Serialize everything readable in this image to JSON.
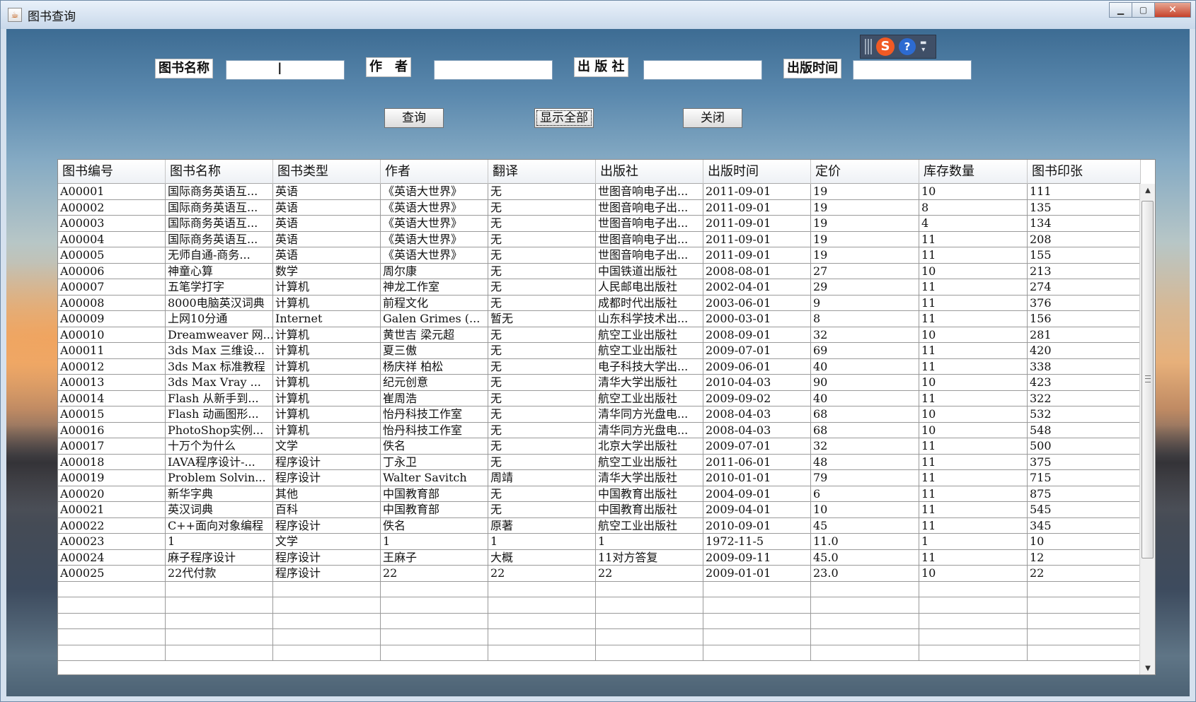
{
  "window": {
    "title": "图书查询"
  },
  "search": {
    "book_name_label": "图书名称",
    "author_label": "作　者",
    "publisher_label": "出 版 社",
    "pub_date_label": "出版时间",
    "book_name_value": "",
    "author_value": "",
    "publisher_value": "",
    "pub_date_value": ""
  },
  "buttons": {
    "query": "查询",
    "show_all": "显示全部",
    "close": "关闭"
  },
  "icons": {
    "app": "java-cup-icon",
    "ime_s": "S",
    "ime_help": "?"
  },
  "table": {
    "headers": [
      "图书编号",
      "图书名称",
      "图书类型",
      "作者",
      "翻译",
      "出版社",
      "出版时间",
      "定价",
      "库存数量",
      "图书印张"
    ],
    "rows": [
      [
        "A00001",
        "国际商务英语互...",
        "英语",
        "《英语大世界》",
        "无",
        "世图音响电子出...",
        "2011-09-01",
        "19",
        "10",
        "111"
      ],
      [
        "A00002",
        "国际商务英语互...",
        "英语",
        "《英语大世界》",
        "无",
        "世图音响电子出...",
        "2011-09-01",
        "19",
        "8",
        "135"
      ],
      [
        "A00003",
        "国际商务英语互...",
        "英语",
        "《英语大世界》",
        "无",
        "世图音响电子出...",
        "2011-09-01",
        "19",
        "4",
        "134"
      ],
      [
        "A00004",
        "国际商务英语互...",
        "英语",
        "《英语大世界》",
        "无",
        "世图音响电子出...",
        "2011-09-01",
        "19",
        "11",
        "208"
      ],
      [
        "A00005",
        "无师自通-商务...",
        "英语",
        "《英语大世界》",
        "无",
        "世图音响电子出...",
        "2011-09-01",
        "19",
        "11",
        "155"
      ],
      [
        "A00006",
        "神童心算",
        "数学",
        "周尔康",
        "无",
        "中国铁道出版社",
        "2008-08-01",
        "27",
        "10",
        "213"
      ],
      [
        "A00007",
        "五笔学打字",
        "计算机",
        "神龙工作室",
        "无",
        "人民邮电出版社",
        "2002-04-01",
        "29",
        "11",
        "274"
      ],
      [
        "A00008",
        "8000电脑英汉词典",
        "计算机",
        "前程文化",
        "无",
        "成都时代出版社",
        "2003-06-01",
        "9",
        "11",
        "376"
      ],
      [
        "A00009",
        "上网10分通",
        "Internet",
        "Galen Grimes (...",
        "暂无",
        "山东科学技术出...",
        "2000-03-01",
        "8",
        "11",
        "156"
      ],
      [
        "A00010",
        "Dreamweaver 网...",
        "计算机",
        "黄世吉 梁元超",
        "无",
        "航空工业出版社",
        "2008-09-01",
        "32",
        "10",
        "281"
      ],
      [
        "A00011",
        "3ds Max 三维设...",
        "计算机",
        "夏三傲",
        "无",
        "航空工业出版社",
        "2009-07-01",
        "69",
        "11",
        "420"
      ],
      [
        "A00012",
        "3ds Max 标准教程",
        "计算机",
        "杨庆祥 柏松",
        "无",
        "电子科技大学出...",
        "2009-06-01",
        "40",
        "11",
        "338"
      ],
      [
        "A00013",
        "3ds Max Vray ...",
        "计算机",
        "纪元创意",
        "无",
        "清华大学出版社",
        "2010-04-03",
        "90",
        "10",
        "423"
      ],
      [
        "A00014",
        "Flash 从新手到...",
        "计算机",
        "崔周浩",
        "无",
        "航空工业出版社",
        "2009-09-02",
        "40",
        "11",
        "322"
      ],
      [
        "A00015",
        "Flash 动画图形...",
        "计算机",
        "怡丹科技工作室",
        "无",
        "清华同方光盘电...",
        "2008-04-03",
        "68",
        "10",
        "532"
      ],
      [
        "A00016",
        "PhotoShop实例...",
        "计算机",
        "怡丹科技工作室",
        "无",
        "清华同方光盘电...",
        "2008-04-03",
        "68",
        "10",
        "548"
      ],
      [
        "A00017",
        "十万个为什么",
        "文学",
        "佚名",
        "无",
        "北京大学出版社",
        "2009-07-01",
        "32",
        "11",
        "500"
      ],
      [
        "A00018",
        "IAVA程序设计-...",
        "程序设计",
        "丁永卫",
        "无",
        "航空工业出版社",
        "2011-06-01",
        "48",
        "11",
        "375"
      ],
      [
        "A00019",
        "Problem Solvin...",
        "程序设计",
        "Walter Savitch",
        "周靖",
        "清华大学出版社",
        "2010-01-01",
        "79",
        "11",
        "715"
      ],
      [
        "A00020",
        "新华字典",
        "其他",
        "中国教育部",
        "无",
        "中国教育出版社",
        "2004-09-01",
        "6",
        "11",
        "875"
      ],
      [
        "A00021",
        "英汉词典",
        "百科",
        "中国教育部",
        "无",
        "中国教育出版社",
        "2009-04-01",
        "10",
        "11",
        "545"
      ],
      [
        "A00022",
        "C++面向对象编程",
        "程序设计",
        "佚名",
        "原著",
        "航空工业出版社",
        "2010-09-01",
        "45",
        "11",
        "345"
      ],
      [
        "A00023",
        "1",
        "文学",
        "1",
        "1",
        "1",
        "1972-11-5",
        "11.0",
        "1",
        "10"
      ],
      [
        "A00024",
        "麻子程序设计",
        "程序设计",
        "王麻子",
        "大概",
        "11对方答复",
        "2009-09-11",
        "45.0",
        "11",
        "12"
      ],
      [
        "A00025",
        "22代付款",
        "程序设计",
        "22",
        "22",
        "22",
        "2009-01-01",
        "23.0",
        "10",
        "22"
      ],
      [
        "",
        "",
        "",
        "",
        "",
        "",
        "",
        "",
        "",
        ""
      ],
      [
        "",
        "",
        "",
        "",
        "",
        "",
        "",
        "",
        "",
        ""
      ],
      [
        "",
        "",
        "",
        "",
        "",
        "",
        "",
        "",
        "",
        ""
      ],
      [
        "",
        "",
        "",
        "",
        "",
        "",
        "",
        "",
        "",
        ""
      ],
      [
        "",
        "",
        "",
        "",
        "",
        "",
        "",
        "",
        "",
        ""
      ]
    ]
  }
}
